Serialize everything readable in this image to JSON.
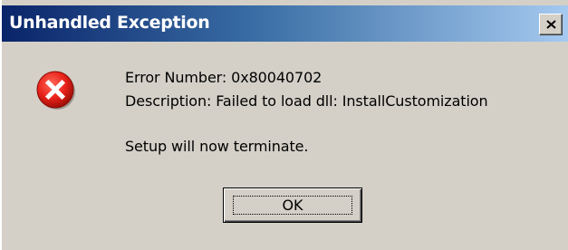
{
  "window": {
    "title": "Unhandled Exception",
    "close_glyph": "x"
  },
  "message": {
    "error_number": "Error Number: 0x80040702",
    "description": "Description: Failed to load dll: InstallCustomization",
    "terminate": "Setup will now terminate."
  },
  "buttons": {
    "ok_label": "OK"
  },
  "icons": {
    "error": "error-icon",
    "close": "close-icon"
  },
  "colors": {
    "titlebar_start": "#0a246a",
    "titlebar_end": "#a6caf0",
    "face": "#d4d0c8",
    "error_red": "#e8221a"
  }
}
